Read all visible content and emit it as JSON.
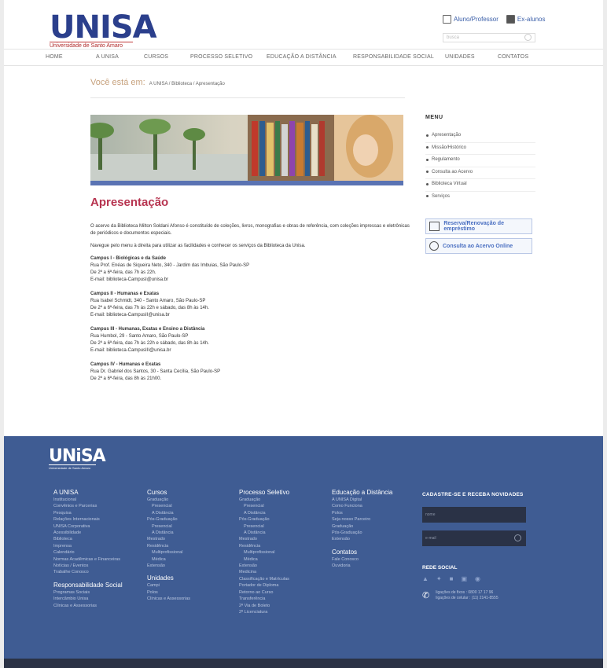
{
  "header": {
    "logo_word": "UNISA",
    "logo_subtitle": "Universidade de Santo Amaro",
    "links": [
      "Aluno/Professor",
      "Ex-alunos"
    ],
    "search_placeholder": "busca"
  },
  "nav": [
    "HOME",
    "A UNISA",
    "CURSOS",
    "PROCESSO SELETIVO",
    "EDUCAÇÃO A DISTÂNCIA",
    "RESPONSABILIDADE SOCIAL",
    "UNIDADES",
    "CONTATOS"
  ],
  "breadcrumb": {
    "label": "Você está em:",
    "trail": "A UNISA / Biblioteca / Apresentação"
  },
  "main": {
    "title": "Apresentação",
    "intro": "O acervo da Biblioteca Milton Soldani Afonso é constituído de coleções, livros, monografias e obras de referência, com coleções impressas e eletrônicas de periódicos e documentos especiais.",
    "nav_hint": "Navegue pelo menu à direita para utilizar as facilidades e conhecer os serviços da Biblioteca da Unisa.",
    "campuses": [
      {
        "title": "Campus I - Biológicas e da Saúde",
        "lines": [
          "Rua Prof. Enéas de Siqueira Neto, 340 - Jardim das Imbuias, São Paulo-SP",
          "De 2ª a 6ª-feira, das 7h às 22h.",
          "E-mail: biblioteca-CampusI@unisa.br"
        ]
      },
      {
        "title": "Campus II - Humanas e Exatas",
        "lines": [
          "Rua Isabel Schmidt, 340 - Santo Amaro, São Paulo-SP",
          "De 2ª a 6ª-feira, das 7h às 22h e sábado, das 8h às 14h.",
          "E-mail: biblioteca-CampusII@unisa.br"
        ]
      },
      {
        "title": "Campus III - Humanas, Exatas e Ensino a Distância",
        "lines": [
          "Rua Humbol, 29 - Santo Amaro, São Paulo-SP",
          "De 2ª a 6ª-feira, das 7h às 22h e sábado, das 8h às 14h.",
          "E-mail: biblioteca-CampusIII@unisa.br"
        ]
      },
      {
        "title": "Campus IV - Humanas e Exatas",
        "lines": [
          "Rua Dr. Gabriel dos Santos, 30 - Santa Cecília, São Paulo-SP",
          "De 2ª a 6ª-feira, das 8h às 21h00."
        ]
      }
    ]
  },
  "sidebar": {
    "menu_title": "MENU",
    "items": [
      "Apresentação",
      "Missão/Histórico",
      "Regulamento",
      "Consulta ao Acervo",
      "Biblioteca Virtual",
      "Serviços"
    ],
    "reserve_button": "Reserva/Renovação de empréstimo",
    "consult_button": "Consulta ao Acervo Online"
  },
  "footer": {
    "logo_word": "UNiSA",
    "logo_subtitle": "Universidade de Santo Amaro",
    "col1": {
      "title": "A UNISA",
      "items": [
        "Institucional",
        "Convênios e Parcerias",
        "Pesquisa",
        "Relações Internacionais",
        "UNISA Corporativa",
        "Acessibilidade",
        "Biblioteca",
        "Imprensa",
        "Calendário",
        "Normas Acadêmicas e Financeiras",
        "Notícias / Eventos",
        "Trabalhe Conosco"
      ],
      "title2": "Responsabilidade Social",
      "items2": [
        "Programas Sociais",
        "Intercâmbio Unisa",
        "Clínicas e Assessorias"
      ]
    },
    "col2": {
      "title": "Cursos",
      "items": [
        "Graduação",
        "Presencial",
        "A Distância",
        "Pós-Graduação",
        "Presencial",
        "A Distância",
        "Mestrado",
        "Residência",
        "Multiprofissional",
        "Médica",
        "Extensão"
      ],
      "title2": "Unidades",
      "items2": [
        "Campi",
        "Polos",
        "Clínicas e Assessorias"
      ]
    },
    "col3": {
      "title": "Processo Seletivo",
      "items": [
        "Graduação",
        "Presencial",
        "A Distância",
        "Pós-Graduação",
        "Presencial",
        "A Distância",
        "Mestrado",
        "Residência",
        "Multiprofissional",
        "Médica",
        "Extensão",
        "Medicina",
        "Classificação e Matrículas",
        "Portador de Diploma",
        "Retorno ao Curso",
        "Transferência",
        "2ª Via de Boleto",
        "2ª Licenciatura"
      ]
    },
    "col4": {
      "title": "Educação a Distância",
      "items": [
        "A UNISA Digital",
        "Como Funciona",
        "Polos",
        "Seja nosso Parceiro",
        "Graduação",
        "Pós-Graduação",
        "Extensão"
      ],
      "title2": "Contatos",
      "items2": [
        "Fale Conosco",
        "Ouvidoria"
      ]
    },
    "newsletter": {
      "title": "CADASTRE-SE E RECEBA NOVIDADES",
      "name_placeholder": "nome",
      "email_placeholder": "e-mail"
    },
    "social_title": "REDE SOCIAL",
    "phone": [
      "ligações de fixos : 0800 17 17 96",
      "ligações de celular : (11) 2141-8555"
    ]
  }
}
